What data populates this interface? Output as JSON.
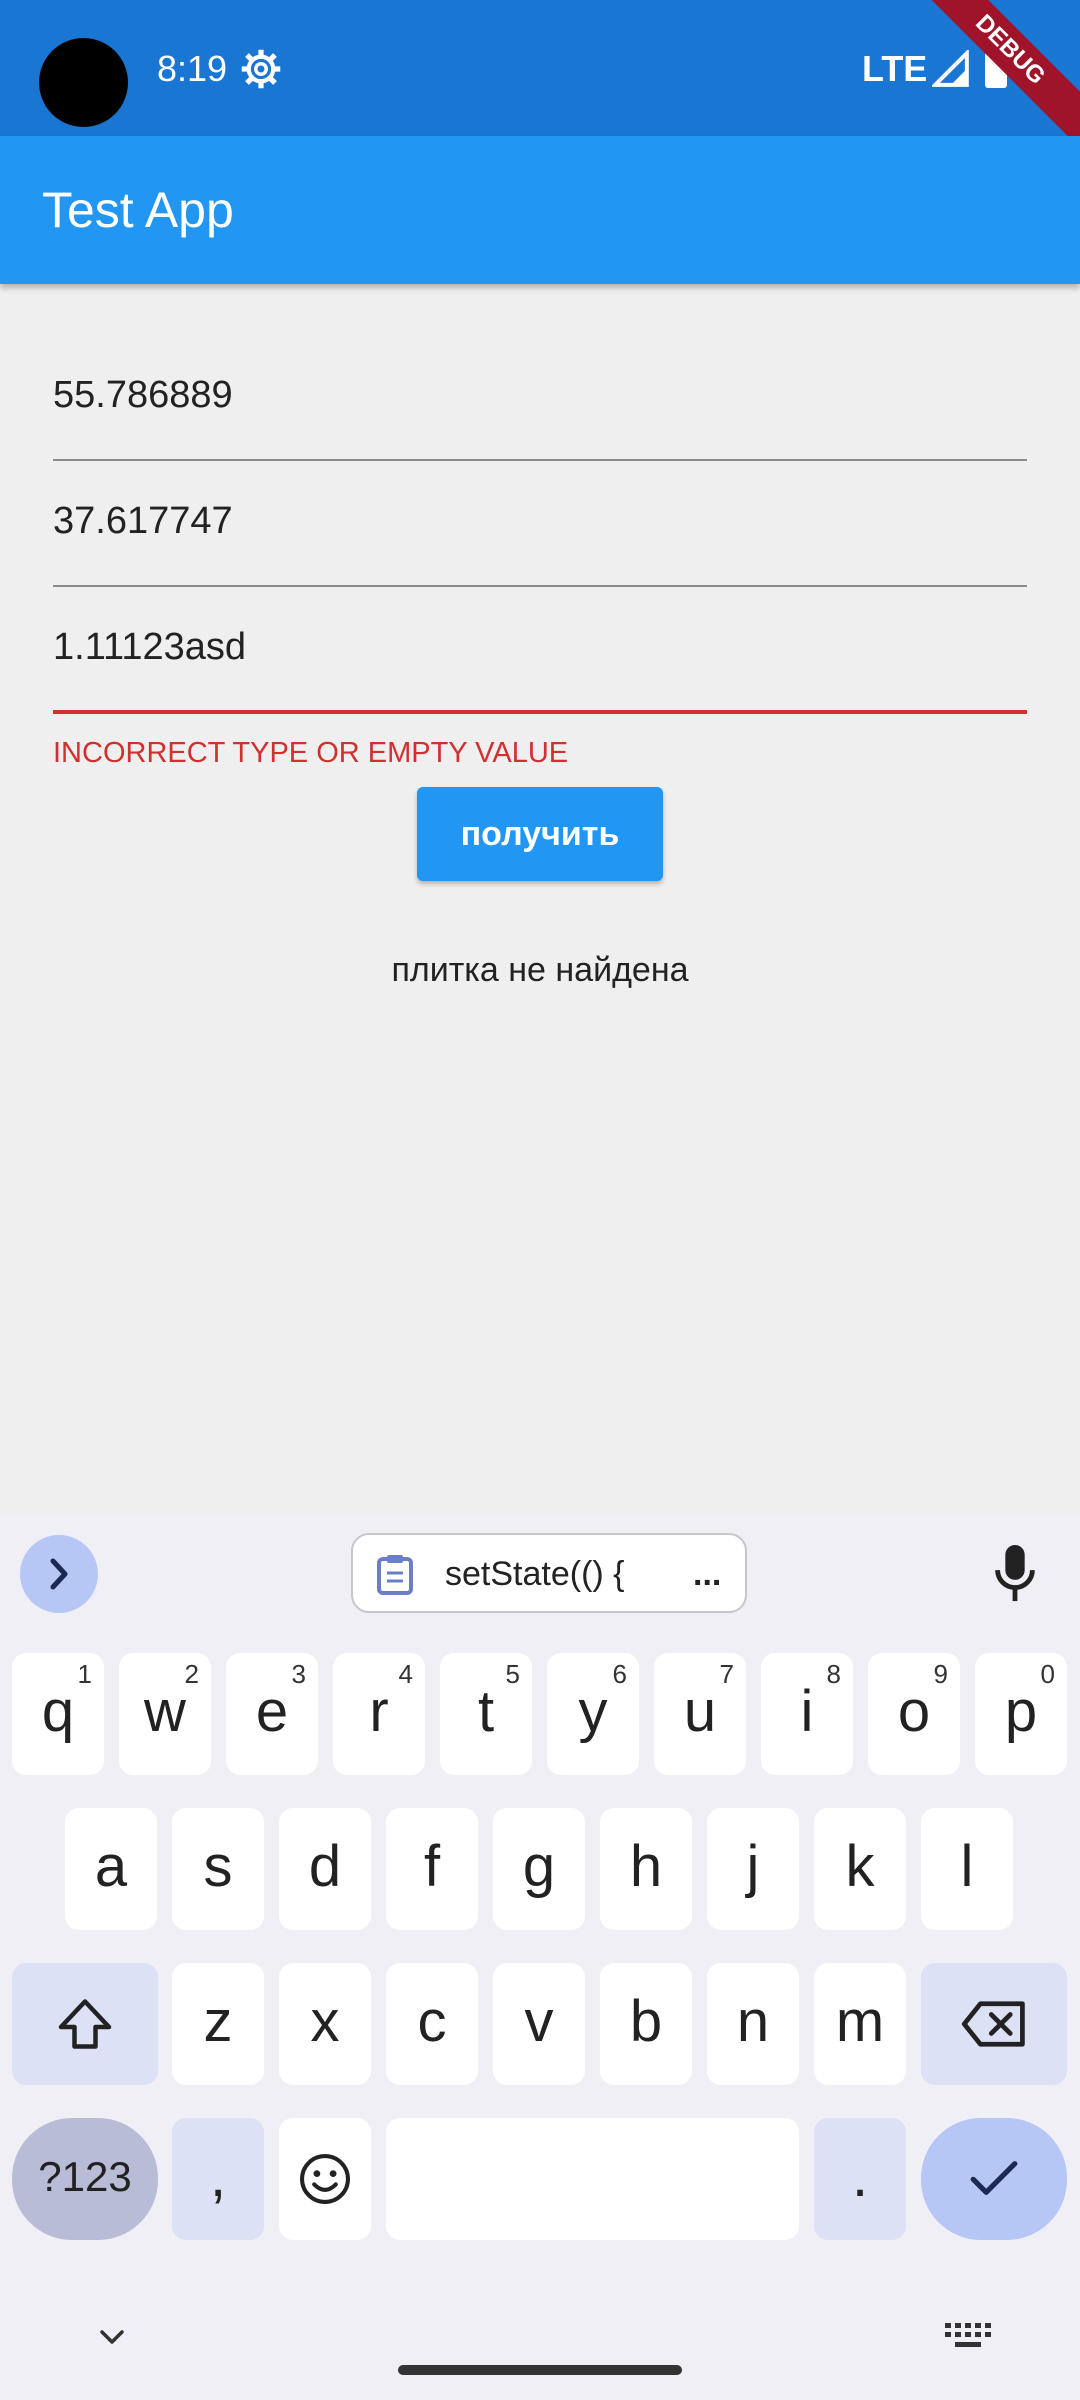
{
  "status_bar": {
    "time": "8:19",
    "network": "LTE",
    "debug_banner": "DEBUG"
  },
  "app_bar": {
    "title": "Test App"
  },
  "form": {
    "fields": [
      {
        "value": "55.786889"
      },
      {
        "value": "37.617747"
      },
      {
        "value": "1.11123asd",
        "error": "INCORRECT TYPE OR EMPTY VALUE"
      }
    ],
    "submit_label": "получить",
    "result_text": "плитка не найдена"
  },
  "keyboard": {
    "clipboard_chip": "setState(() {",
    "clipboard_more": "...",
    "row1": [
      {
        "letter": "q",
        "num": "1"
      },
      {
        "letter": "w",
        "num": "2"
      },
      {
        "letter": "e",
        "num": "3"
      },
      {
        "letter": "r",
        "num": "4"
      },
      {
        "letter": "t",
        "num": "5"
      },
      {
        "letter": "y",
        "num": "6"
      },
      {
        "letter": "u",
        "num": "7"
      },
      {
        "letter": "i",
        "num": "8"
      },
      {
        "letter": "o",
        "num": "9"
      },
      {
        "letter": "p",
        "num": "0"
      }
    ],
    "row2": [
      "a",
      "s",
      "d",
      "f",
      "g",
      "h",
      "j",
      "k",
      "l"
    ],
    "row3": [
      "z",
      "x",
      "c",
      "v",
      "b",
      "n",
      "m"
    ],
    "symbols_label": "?123",
    "comma": ",",
    "period": "."
  }
}
